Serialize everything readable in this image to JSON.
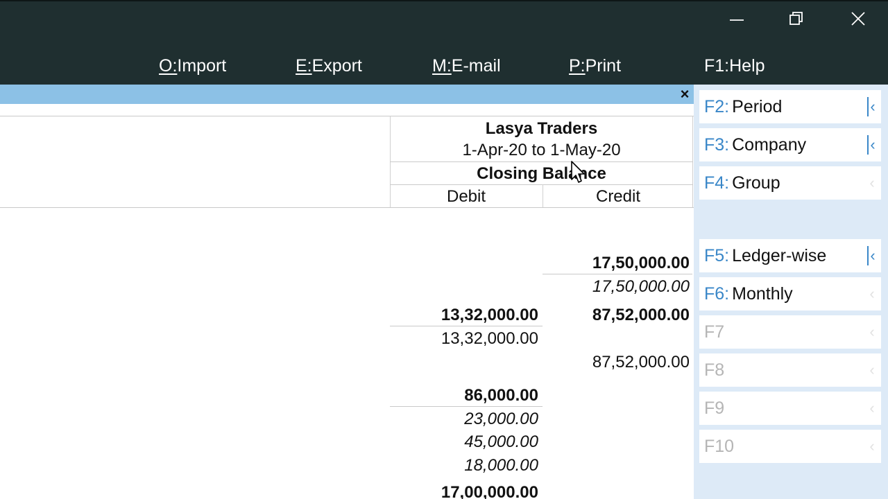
{
  "window": {
    "controls": {
      "minimize": "minimize-icon",
      "maximize": "restore-icon",
      "close": "close-icon"
    }
  },
  "menu": {
    "import": {
      "key": "O:",
      "label": "Import"
    },
    "export": {
      "key": "E:",
      "label": "Export"
    },
    "email": {
      "key": "M:",
      "label": "E-mail"
    },
    "print": {
      "key": "P:",
      "label": "Print"
    },
    "help": {
      "key": "F1:",
      "label": "Help"
    }
  },
  "report": {
    "close_symbol": "×",
    "company": "Lasya Traders",
    "period": "1-Apr-20 to 1-May-20",
    "column_group": "Closing Balance",
    "col_debit": "Debit",
    "col_credit": "Credit",
    "rows": [
      {
        "debit": "",
        "credit": "17,50,000.00",
        "style": "bold"
      },
      {
        "debit": "",
        "credit": "17,50,000.00",
        "style": "italic"
      },
      {
        "debit": "13,32,000.00",
        "credit": "87,52,000.00",
        "style": "bold"
      },
      {
        "debit": "13,32,000.00",
        "credit": "",
        "style": "normal"
      },
      {
        "debit": "",
        "credit": "87,52,000.00",
        "style": "normal"
      },
      {
        "debit": "86,000.00",
        "credit": "",
        "style": "bold"
      },
      {
        "debit": "23,000.00",
        "credit": "",
        "style": "italic"
      },
      {
        "debit": "45,000.00",
        "credit": "",
        "style": "italic"
      },
      {
        "debit": "18,000.00",
        "credit": "",
        "style": "italic"
      },
      {
        "debit": "17,00,000.00",
        "credit": "",
        "style": "bold"
      }
    ]
  },
  "function_keys": [
    {
      "key": "F2:",
      "label": "Period",
      "enabled": true,
      "chevron": "‹"
    },
    {
      "key": "F3:",
      "label": "Company",
      "enabled": true,
      "chevron": "‹"
    },
    {
      "key": "F4:",
      "label": "Group",
      "enabled": true,
      "chevron": "‹"
    },
    {
      "key": "F5:",
      "label": "Ledger-wise",
      "enabled": true,
      "chevron": "‹"
    },
    {
      "key": "F6:",
      "label": "Monthly",
      "enabled": true,
      "chevron": "‹"
    },
    {
      "key": "F7",
      "label": "",
      "enabled": false,
      "chevron": "‹"
    },
    {
      "key": "F8",
      "label": "",
      "enabled": false,
      "chevron": "‹"
    },
    {
      "key": "F9",
      "label": "",
      "enabled": false,
      "chevron": "‹"
    },
    {
      "key": "F10",
      "label": "",
      "enabled": false,
      "chevron": "‹"
    }
  ]
}
